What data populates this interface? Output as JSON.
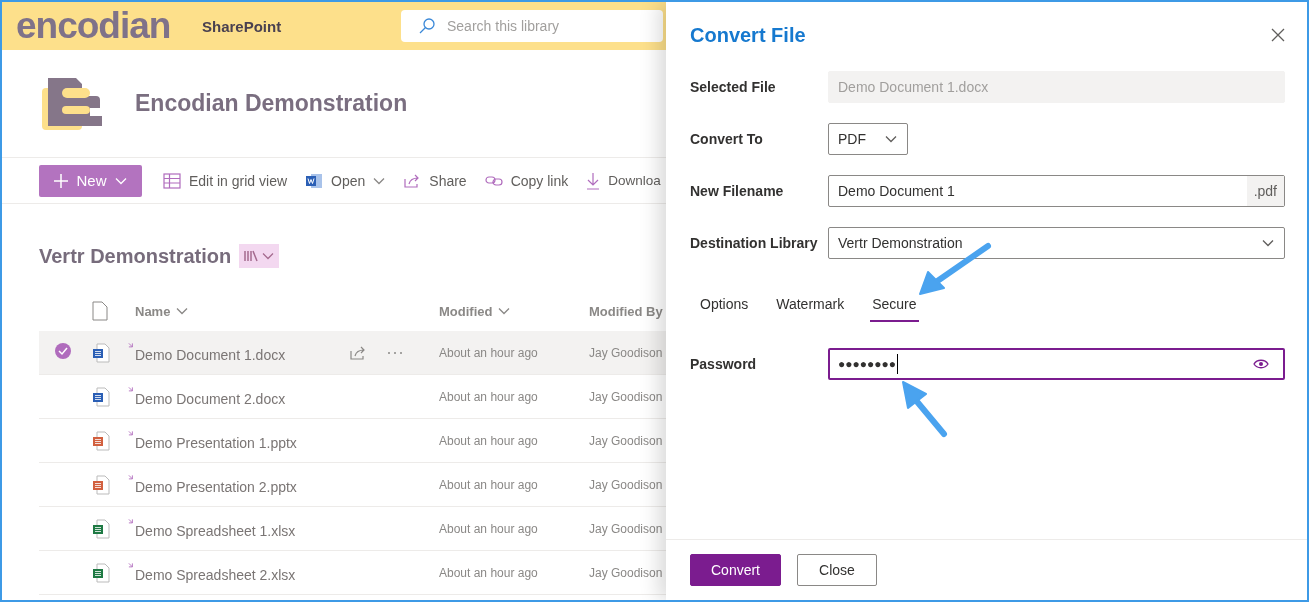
{
  "header": {
    "logo": "encodian",
    "app_name": "SharePoint",
    "search": {
      "placeholder": "Search this library"
    }
  },
  "site": {
    "title": "Encodian Demonstration"
  },
  "command_bar": [
    {
      "kind": "new",
      "label": "New",
      "menu": true
    },
    {
      "kind": "grid",
      "label": "Edit in grid view",
      "menu": false
    },
    {
      "kind": "open",
      "label": "Open",
      "menu": true
    },
    {
      "kind": "share",
      "label": "Share",
      "menu": false
    },
    {
      "kind": "link",
      "label": "Copy link",
      "menu": false
    },
    {
      "kind": "download",
      "label": "Downloa",
      "menu": false
    }
  ],
  "library": {
    "title": "Vertr Demonstration"
  },
  "table": {
    "columns": [
      {
        "label": "Name",
        "sortable": true
      },
      {
        "label": "Modified",
        "sortable": true
      },
      {
        "label": "Modified By"
      }
    ],
    "rows": [
      {
        "kind": "word",
        "name": "Demo Document 1.docx",
        "new": true,
        "modified": "About an hour ago",
        "modified_by": "Jay Goodison",
        "selected": true
      },
      {
        "kind": "word",
        "name": "Demo Document 2.docx",
        "new": true,
        "modified": "About an hour ago",
        "modified_by": "Jay Goodison",
        "selected": false
      },
      {
        "kind": "powerpoint",
        "name": "Demo Presentation 1.pptx",
        "new": true,
        "modified": "About an hour ago",
        "modified_by": "Jay Goodison",
        "selected": false
      },
      {
        "kind": "powerpoint",
        "name": "Demo Presentation 2.pptx",
        "new": true,
        "modified": "About an hour ago",
        "modified_by": "Jay Goodison",
        "selected": false
      },
      {
        "kind": "excel",
        "name": "Demo Spreadsheet 1.xlsx",
        "new": true,
        "modified": "About an hour ago",
        "modified_by": "Jay Goodison",
        "selected": false
      },
      {
        "kind": "excel",
        "name": "Demo Spreadsheet 2.xlsx",
        "new": true,
        "modified": "About an hour ago",
        "modified_by": "Jay Goodison",
        "selected": false
      }
    ]
  },
  "panel": {
    "title": "Convert File",
    "fields": [
      {
        "kind": "readonly",
        "label": "Selected File",
        "value": "Demo Document 1.docx"
      },
      {
        "kind": "dropdown_small",
        "label": "Convert To",
        "value": "PDF"
      },
      {
        "kind": "suffix",
        "label": "New Filename",
        "value": "Demo Document 1",
        "suffix": ".pdf"
      },
      {
        "kind": "dropdown",
        "label": "Destination Library",
        "value": "Vertr Demonstration"
      }
    ],
    "tabs": [
      {
        "label": "Options",
        "selected": false
      },
      {
        "label": "Watermark",
        "selected": false
      },
      {
        "label": "Secure",
        "selected": true
      }
    ],
    "password": {
      "label": "Password",
      "value": "●●●●●●●●",
      "focused": true
    },
    "buttons": [
      {
        "kind": "primary",
        "label": "Convert"
      },
      {
        "kind": "secondary",
        "label": "Close"
      }
    ]
  }
}
